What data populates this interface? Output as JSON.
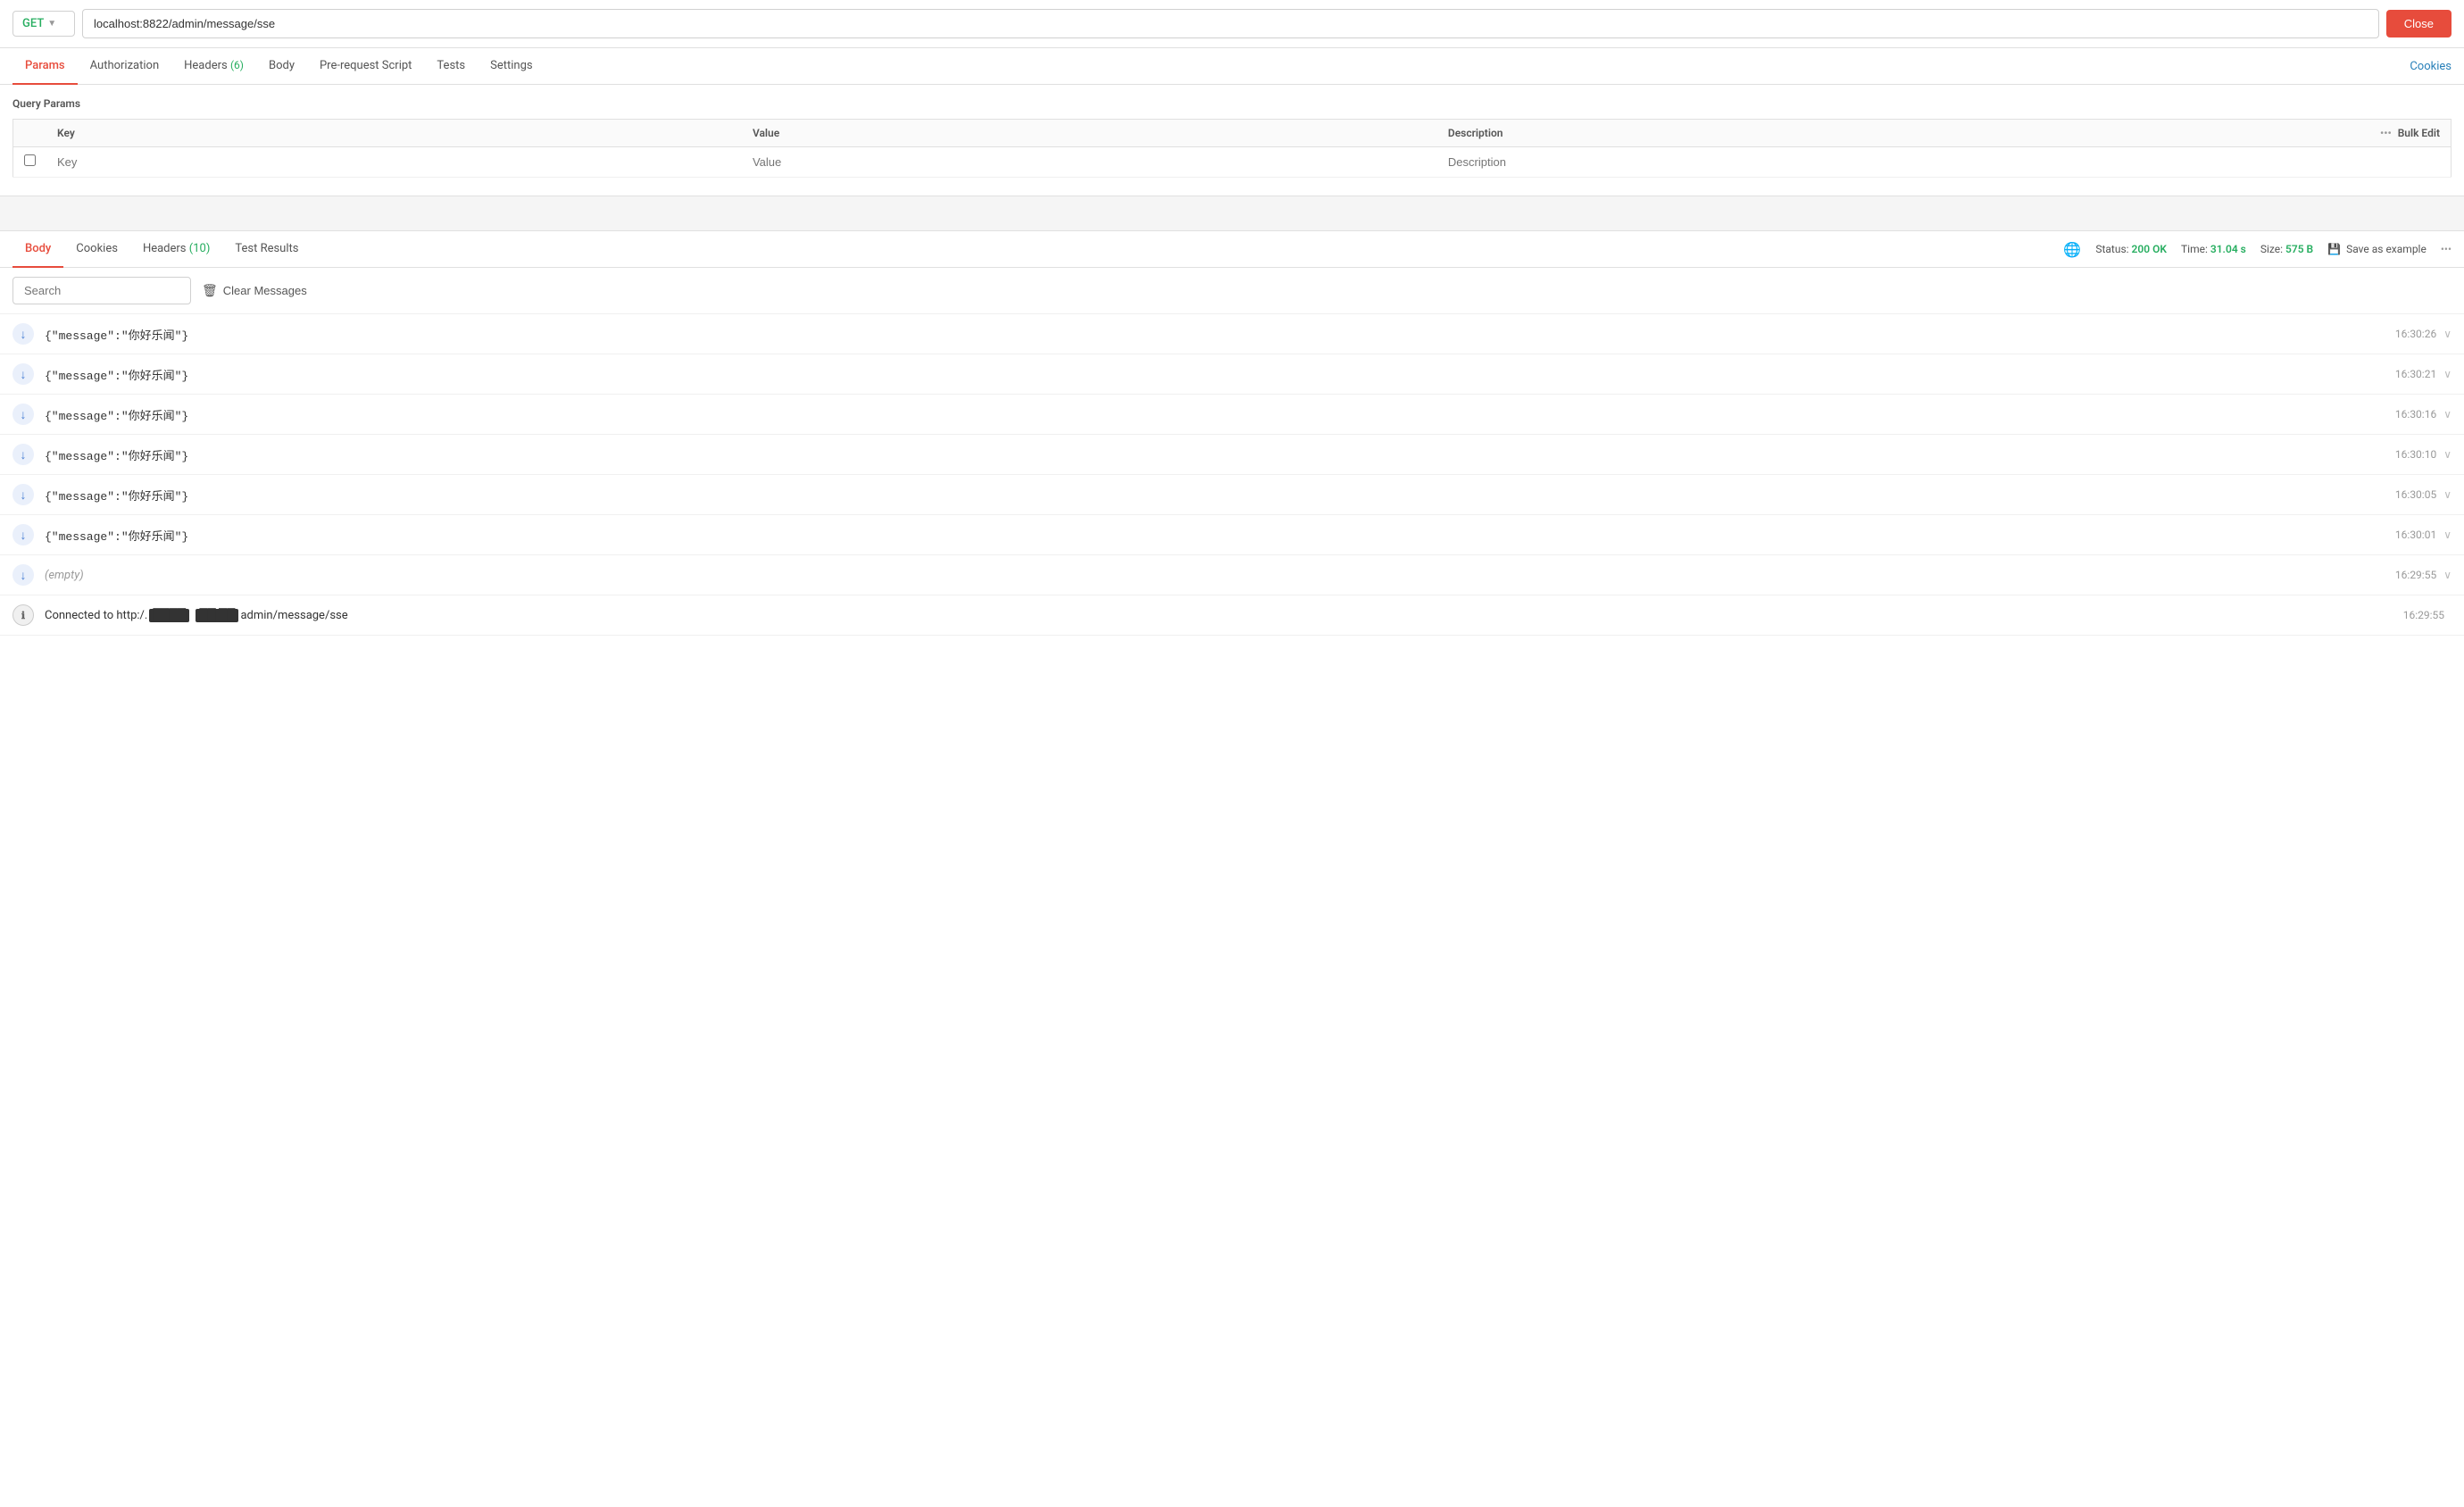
{
  "url_bar": {
    "method": "GET",
    "url": "localhost:8822/admin/message/sse",
    "close_label": "Close"
  },
  "tabs_top": {
    "tabs": [
      {
        "label": "Params",
        "active": true,
        "badge": null
      },
      {
        "label": "Authorization",
        "active": false,
        "badge": null
      },
      {
        "label": "Headers",
        "active": false,
        "badge": "6"
      },
      {
        "label": "Body",
        "active": false,
        "badge": null
      },
      {
        "label": "Pre-request Script",
        "active": false,
        "badge": null
      },
      {
        "label": "Tests",
        "active": false,
        "badge": null
      },
      {
        "label": "Settings",
        "active": false,
        "badge": null
      }
    ],
    "cookies_link": "Cookies"
  },
  "query_params": {
    "title": "Query Params",
    "columns": [
      "Key",
      "Value",
      "Description",
      "Bulk Edit"
    ],
    "placeholder_key": "Key",
    "placeholder_value": "Value",
    "placeholder_description": "Description"
  },
  "response_tabs": {
    "tabs": [
      {
        "label": "Body",
        "active": true,
        "badge": null
      },
      {
        "label": "Cookies",
        "active": false,
        "badge": null
      },
      {
        "label": "Headers",
        "active": false,
        "badge": "10"
      },
      {
        "label": "Test Results",
        "active": false,
        "badge": null
      }
    ],
    "status_label": "Status:",
    "status_value": "200 OK",
    "time_label": "Time:",
    "time_value": "31.04 s",
    "size_label": "Size:",
    "size_value": "575 B",
    "save_example": "Save as example"
  },
  "search_bar": {
    "placeholder": "Search",
    "clear_messages_label": "Clear Messages"
  },
  "messages": [
    {
      "icon": "down",
      "content": "{\"message\":\"你好乐闻\"}",
      "time": "16:30:26",
      "type": "data"
    },
    {
      "icon": "down",
      "content": "{\"message\":\"你好乐闻\"}",
      "time": "16:30:21",
      "type": "data"
    },
    {
      "icon": "down",
      "content": "{\"message\":\"你好乐闻\"}",
      "time": "16:30:16",
      "type": "data"
    },
    {
      "icon": "down",
      "content": "{\"message\":\"你好乐闻\"}",
      "time": "16:30:10",
      "type": "data"
    },
    {
      "icon": "down",
      "content": "{\"message\":\"你好乐闻\"}",
      "time": "16:30:05",
      "type": "data"
    },
    {
      "icon": "down",
      "content": "{\"message\":\"你好乐闻\"}",
      "time": "16:30:01",
      "type": "data"
    },
    {
      "icon": "down",
      "content": "(empty)",
      "time": "16:29:55",
      "type": "empty"
    },
    {
      "icon": "info",
      "content": "Connected to http:/admin/message/sse",
      "time": "16:29:55",
      "type": "connected"
    }
  ],
  "colors": {
    "accent_red": "#e74c3c",
    "accent_green": "#27ae60",
    "accent_blue": "#2980b9",
    "icon_blue": "#4a7fd4"
  }
}
